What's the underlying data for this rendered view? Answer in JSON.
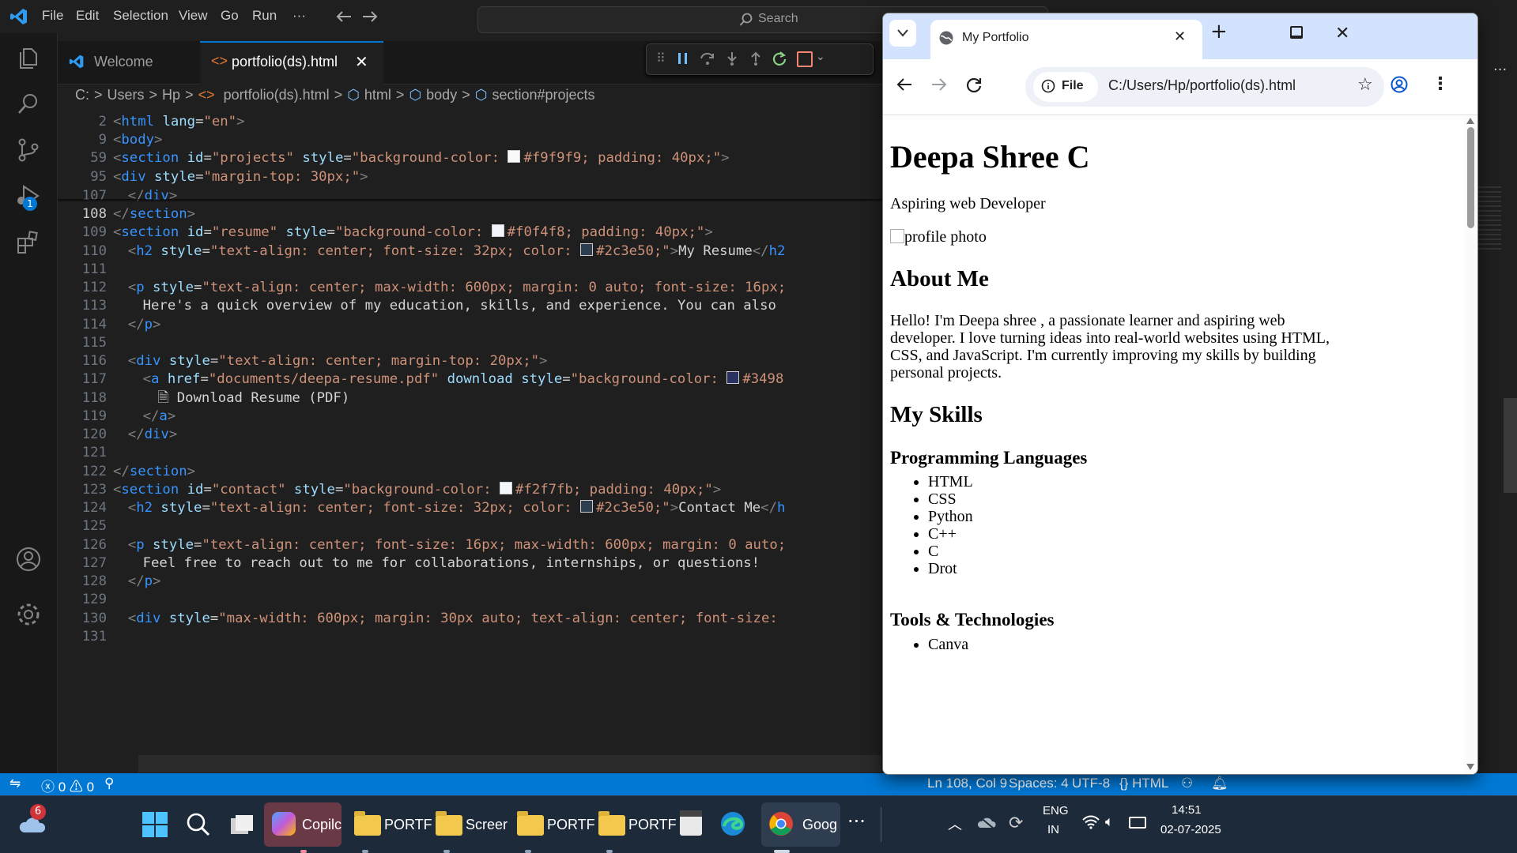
{
  "vscode": {
    "menu": [
      "File",
      "Edit",
      "Selection",
      "View",
      "Go",
      "Run",
      "···"
    ],
    "search_placeholder": "Search",
    "tabs": [
      {
        "label": "Welcome"
      },
      {
        "label": "portfolio(ds).html"
      }
    ],
    "breadcrumb": [
      "C:",
      ">",
      "Users",
      ">",
      "Hp",
      ">",
      "portfolio(ds).html",
      ">",
      "html",
      ">",
      "body",
      ">",
      "section#projects"
    ],
    "debug_badge": "1",
    "sticky_lines": [
      {
        "n": "2",
        "code": "<html lang=\"en\">"
      },
      {
        "n": "9",
        "code": "<body>"
      },
      {
        "n": "59",
        "code": "<section id=\"projects\" style=\"background-color: #f9f9f9; padding: 40px;\">"
      },
      {
        "n": "95",
        "code": "<div style=\"margin-top: 30px;\">"
      }
    ],
    "code_lines": [
      {
        "n": "107",
        "code": "  </div>"
      },
      {
        "n": "108",
        "code": "</section>"
      },
      {
        "n": "109",
        "code": "<section id=\"resume\" style=\"background-color: #f0f4f8; padding: 40px;\">"
      },
      {
        "n": "110",
        "code": "  <h2 style=\"text-align: center; font-size: 32px; color: #2c3e50;\">My Resume</h2"
      },
      {
        "n": "111",
        "code": ""
      },
      {
        "n": "112",
        "code": "  <p style=\"text-align: center; max-width: 600px; margin: 0 auto; font-size: 16px;"
      },
      {
        "n": "113",
        "code": "    Here's a quick overview of my education, skills, and experience. You can also"
      },
      {
        "n": "114",
        "code": "  </p>"
      },
      {
        "n": "115",
        "code": ""
      },
      {
        "n": "116",
        "code": "  <div style=\"text-align: center; margin-top: 20px;\">"
      },
      {
        "n": "117",
        "code": "    <a href=\"documents/deepa-resume.pdf\" download style=\"background-color: #3498"
      },
      {
        "n": "118",
        "code": "      Download Resume (PDF)"
      },
      {
        "n": "119",
        "code": "    </a>"
      },
      {
        "n": "120",
        "code": "  </div>"
      },
      {
        "n": "121",
        "code": ""
      },
      {
        "n": "122",
        "code": "</section>"
      },
      {
        "n": "123",
        "code": "<section id=\"contact\" style=\"background-color: #f2f7fb; padding: 40px;\">"
      },
      {
        "n": "124",
        "code": "  <h2 style=\"text-align: center; font-size: 32px; color: #2c3e50;\">Contact Me</h"
      },
      {
        "n": "125",
        "code": ""
      },
      {
        "n": "126",
        "code": "  <p style=\"text-align: center; font-size: 16px; max-width: 600px; margin: 0 auto;"
      },
      {
        "n": "127",
        "code": "    Feel free to reach out to me for collaborations, internships, or questions!"
      },
      {
        "n": "128",
        "code": "  </p>"
      },
      {
        "n": "129",
        "code": ""
      },
      {
        "n": "130",
        "code": "  <div style=\"max-width: 600px; margin: 30px auto; text-align: center; font-size:"
      },
      {
        "n": "131",
        "code": ""
      }
    ],
    "status": {
      "errors": "0",
      "warnings": "0",
      "ports": "0",
      "position": "Ln 108, Col 9",
      "spaces": "Spaces: 4",
      "encoding": "UTF-8",
      "language": "{} HTML"
    },
    "colors": {
      "accent": "#0078d4",
      "editor_bg": "#1f1f1f",
      "tag": "#3794ff",
      "attr": "#9cdcfe",
      "string": "#ce9178"
    }
  },
  "chrome": {
    "tab_title": "My Portfolio",
    "file_chip": "File",
    "url": "C:/Users/Hp/portfolio(ds).html",
    "page": {
      "h1": "Deepa Shree C",
      "tagline": "Aspiring web Developer",
      "img_alt": "profile photo",
      "about_heading": "About Me",
      "about_text": "Hello! I'm Deepa shree , a passionate learner and aspiring web developer. I love turning ideas into real-world websites using HTML, CSS, and JavaScript. I'm currently improving my skills by building personal projects.",
      "skills_heading": "My Skills",
      "prog_heading": "Programming Languages",
      "languages": [
        "HTML",
        "CSS",
        "Python",
        "C++",
        "C",
        "Drot"
      ],
      "tools_heading": "Tools & Technologies",
      "tools": [
        "Canva"
      ]
    }
  },
  "taskbar": {
    "weather_badge": "6",
    "apps": [
      {
        "label": "Copilc"
      },
      {
        "label": "PORTF"
      },
      {
        "label": "Screer"
      },
      {
        "label": "PORTF"
      },
      {
        "label": "PORTF"
      },
      {
        "label": "Goog"
      }
    ],
    "lang_top": "ENG",
    "lang_bottom": "IN",
    "time": "14:51",
    "date": "02-07-2025"
  }
}
